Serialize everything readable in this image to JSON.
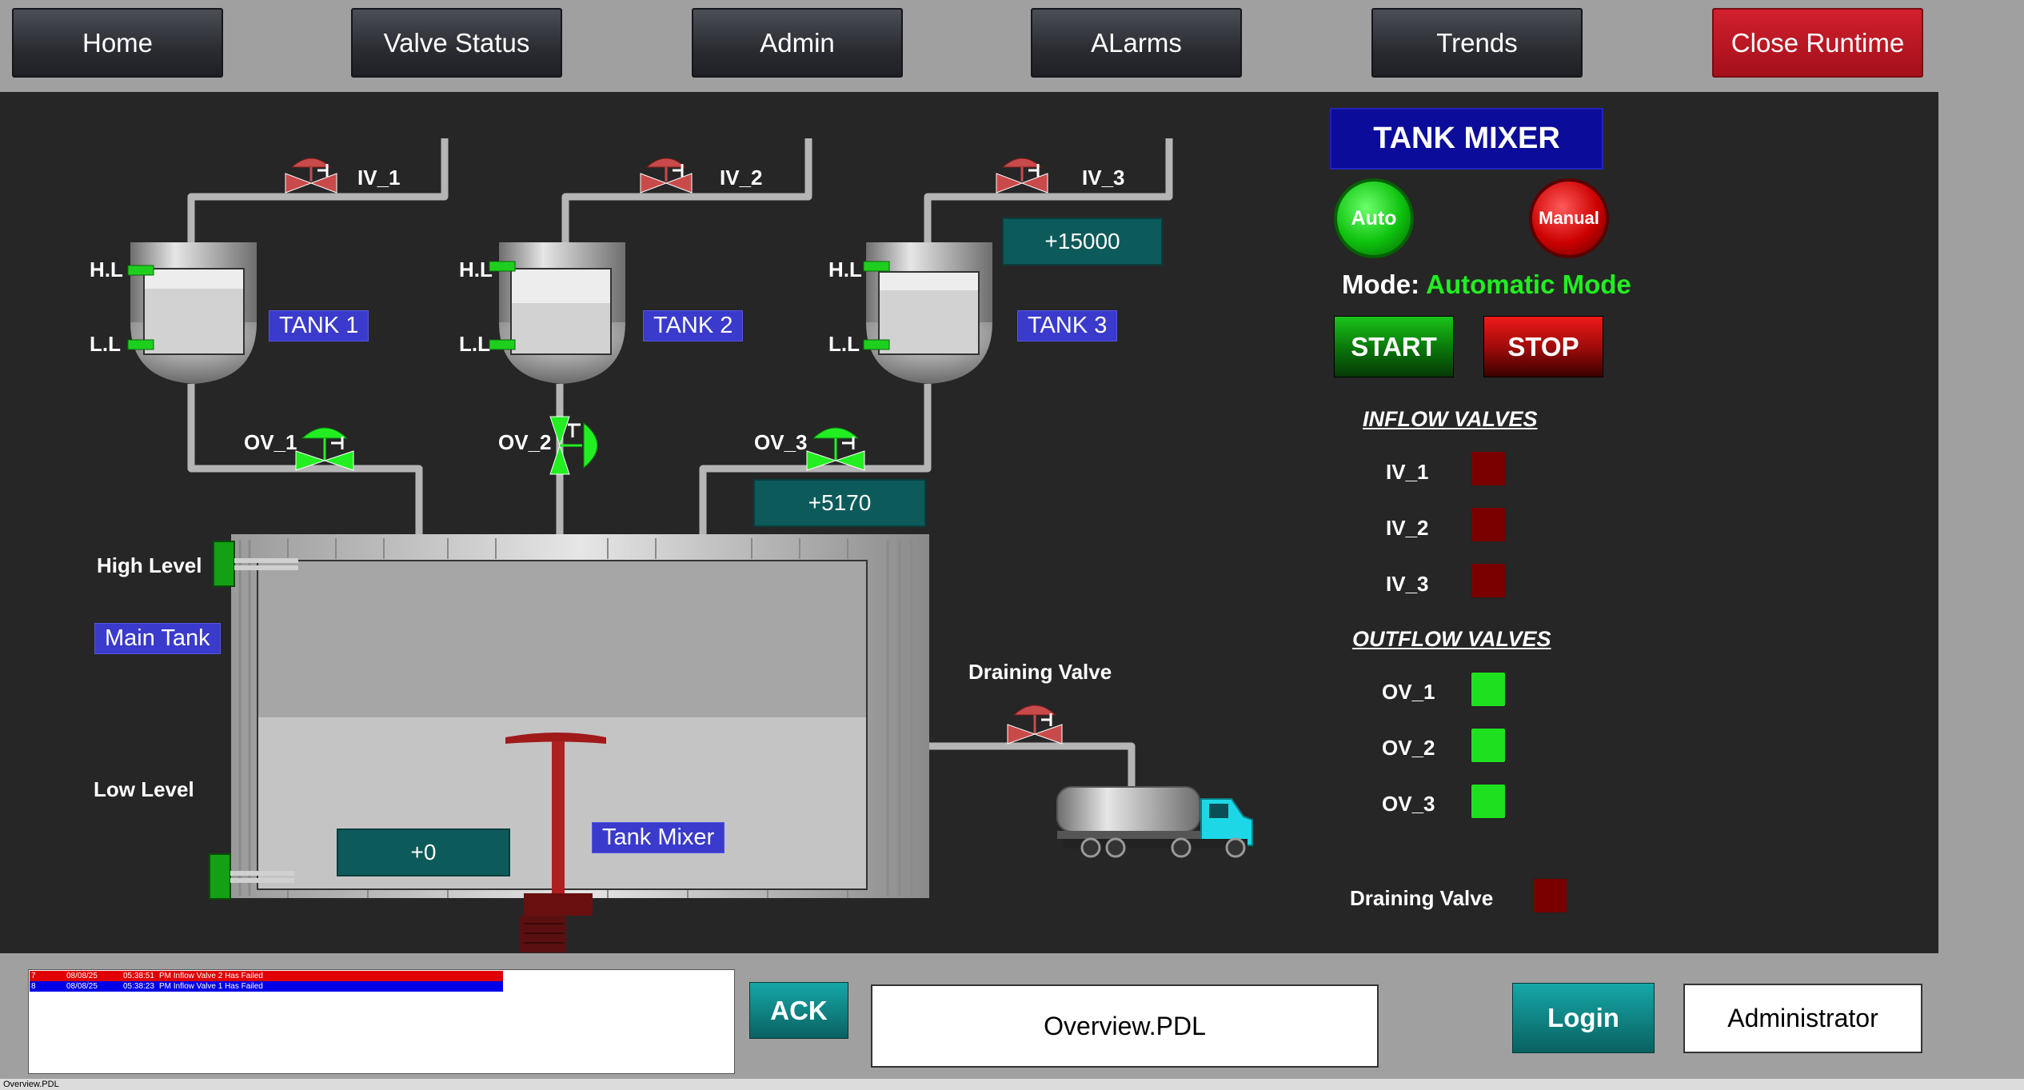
{
  "nav": {
    "home": "Home",
    "valve_status": "Valve Status",
    "admin": "Admin",
    "alarms": "ALarms",
    "trends": "Trends",
    "close_runtime": "Close Runtime"
  },
  "process": {
    "valves": {
      "iv1": "IV_1",
      "iv2": "IV_2",
      "iv3": "IV_3",
      "ov1": "OV_1",
      "ov2": "OV_2",
      "ov3": "OV_3",
      "draining": "Draining Valve"
    },
    "tanks": {
      "t1": "TANK 1",
      "t2": "TANK 2",
      "t3": "TANK 3",
      "hl": "H.L",
      "ll": "L.L",
      "main": "Main Tank",
      "high_level": "High Level",
      "low_level": "Low Level",
      "mixer": "Tank Mixer"
    },
    "values": {
      "tank3_inflow": "+15000",
      "ov3_flow": "+5170",
      "mixer_value": "+0"
    }
  },
  "panel": {
    "title": "TANK MIXER",
    "auto": "Auto",
    "manual": "Manual",
    "mode_label": "Mode:",
    "mode_value": "Automatic Mode",
    "start": "START",
    "stop": "STOP",
    "inflow_header": "INFLOW VALVES",
    "outflow_header": "OUTFLOW VALVES",
    "inflow": [
      {
        "label": "IV_1",
        "state": "off"
      },
      {
        "label": "IV_2",
        "state": "off"
      },
      {
        "label": "IV_3",
        "state": "off"
      }
    ],
    "outflow": [
      {
        "label": "OV_1",
        "state": "on"
      },
      {
        "label": "OV_2",
        "state": "on"
      },
      {
        "label": "OV_3",
        "state": "on"
      }
    ],
    "draining_label": "Draining Valve",
    "draining_state": "off"
  },
  "alarms": [
    {
      "num": "7",
      "date": "08/08/25",
      "time": "05:38:51",
      "text": "PM Inflow Valve 2 Has Failed",
      "color": "#e00000"
    },
    {
      "num": "8",
      "date": "08/08/25",
      "time": "05:38:23",
      "text": "PM Inflow Valve 1 Has Failed",
      "color": "#0000e8"
    }
  ],
  "bottom": {
    "ack": "ACK",
    "screen": "Overview.PDL",
    "login": "Login",
    "user": "Administrator",
    "status": "Overview.PDL"
  },
  "colors": {
    "valve_red": "#c94a4a",
    "valve_green": "#22ee22",
    "indicator_off": "#7a0000",
    "indicator_on": "#1fe01f"
  }
}
